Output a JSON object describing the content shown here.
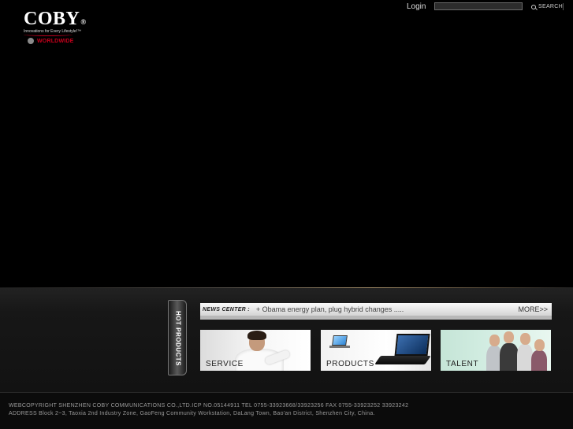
{
  "header": {
    "logo_text": "COBY",
    "logo_registered": "®",
    "tagline": "Innovations for Every Lifestyle!™",
    "worldwide_label": "WORLDWIDE",
    "login_label": "Login",
    "search_value": "",
    "search_label": "SEARCH"
  },
  "hot_products": {
    "label": "HOT PRODUCTS"
  },
  "news": {
    "label": "NEWS CENTER :",
    "item": "+ Obama energy plan, plug hybrid changes .....",
    "more_label": "MORE>>"
  },
  "cards": {
    "service_label": "SERVICE",
    "products_label": "PRODUCTS",
    "talent_label": "TALENT"
  },
  "footer": {
    "line1": "WEBCOPYRIGHT SHENZHEN COBY COMMUNICATIONS CO.,LTD.ICP NO.05144911 TEL 0755-33923668/33923256 FAX 0755-33923252 33923242",
    "line2": "ADDRESS Block 2~3, Taoxia 2nd Industry Zone, GaoFeng Community Workstation, DaLang Town, Bao'an District, Shenzhen City, China."
  },
  "colors": {
    "background": "#000000",
    "brand_red": "#c8001c",
    "panel_accent": "#a08a66"
  }
}
